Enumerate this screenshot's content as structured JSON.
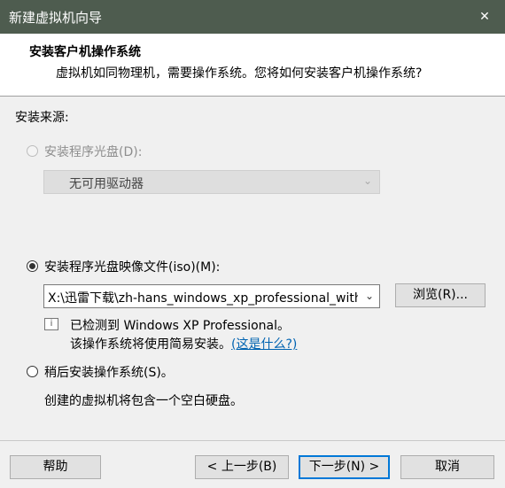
{
  "window": {
    "title": "新建虚拟机向导",
    "close_glyph": "✕"
  },
  "header": {
    "title": "安装客户机操作系统",
    "subtitle": "虚拟机如同物理机，需要操作系统。您将如何安装客户机操作系统?"
  },
  "source_label": "安装来源:",
  "options": {
    "disc": {
      "label": "安装程序光盘(D):",
      "dropdown_value": "无可用驱动器"
    },
    "iso": {
      "label": "安装程序光盘映像文件(iso)(M):",
      "path": "X:\\迅雷下载\\zh-hans_windows_xp_professional_with_s",
      "browse_label": "浏览(R)..."
    },
    "later": {
      "label": "稍后安装操作系统(S)。",
      "description": "创建的虚拟机将包含一个空白硬盘。"
    }
  },
  "detect": {
    "line1": "已检测到 Windows XP Professional。",
    "line2_text": "该操作系统将使用简易安装。",
    "link": "(这是什么?)"
  },
  "buttons": {
    "help": "帮助",
    "back": "< 上一步(B)",
    "next": "下一步(N) >",
    "cancel": "取消"
  }
}
